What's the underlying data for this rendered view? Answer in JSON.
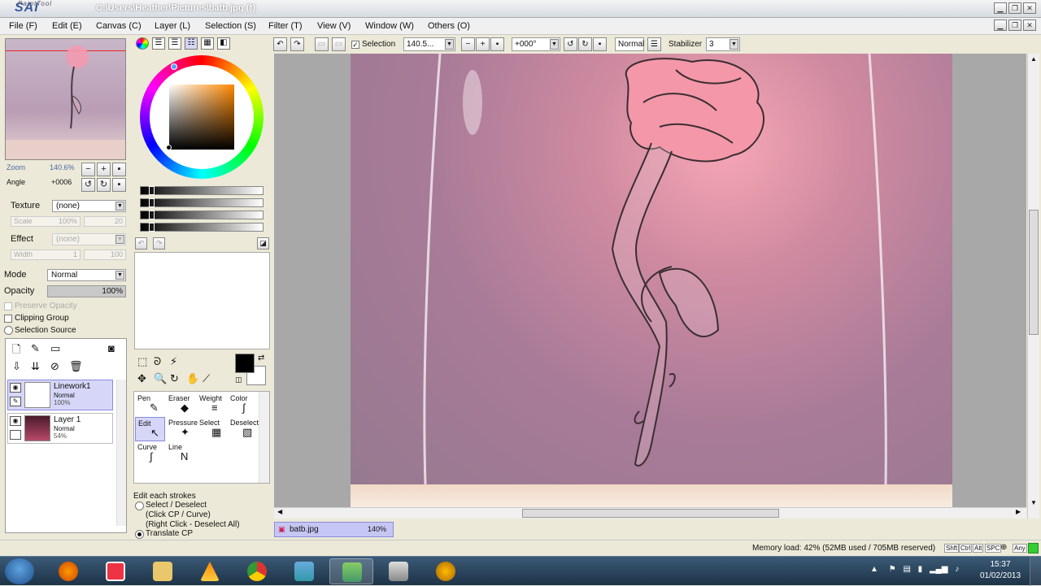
{
  "window": {
    "app_logo": "SAI",
    "app_logo_small": "PaintTool",
    "title": "C:\\Users\\Heather\\Pictures\\batb.jpg (*)"
  },
  "menu": [
    "File (F)",
    "Edit (E)",
    "Canvas (C)",
    "Layer (L)",
    "Selection (S)",
    "Filter (T)",
    "View (V)",
    "Window (W)",
    "Others (O)"
  ],
  "navigator": {
    "zoom_label": "Zoom",
    "zoom_value": "140.6%",
    "angle_label": "Angle",
    "angle_value": "+0006"
  },
  "brush_settings": {
    "texture_label": "Texture",
    "texture_value": "(none)",
    "scale_label": "Scale",
    "scale_value": "100%",
    "scale_num": "20",
    "effect_label": "Effect",
    "effect_value": "(none)",
    "width_label": "Width",
    "width_value": "1",
    "width_num": "100"
  },
  "layer_settings": {
    "mode_label": "Mode",
    "mode_value": "Normal",
    "opacity_label": "Opacity",
    "opacity_value": "100%",
    "preserve_opacity": "Preserve Opacity",
    "clipping_group": "Clipping Group",
    "selection_source": "Selection Source"
  },
  "layers": [
    {
      "name": "Linework1",
      "mode": "Normal",
      "opacity": "100%"
    },
    {
      "name": "Layer 1",
      "mode": "Normal",
      "opacity": "54%"
    }
  ],
  "tools": [
    {
      "label": "Pen",
      "icon": "✎"
    },
    {
      "label": "Eraser",
      "icon": "◆"
    },
    {
      "label": "Weight",
      "icon": "≡"
    },
    {
      "label": "Color",
      "icon": "∫"
    },
    {
      "label": "Edit",
      "icon": "↖"
    },
    {
      "label": "Pressure",
      "icon": "✦"
    },
    {
      "label": "Select",
      "icon": "▦"
    },
    {
      "label": "Deselect",
      "icon": "▧"
    },
    {
      "label": "Curve",
      "icon": "∫"
    },
    {
      "label": "Line",
      "icon": "N"
    }
  ],
  "edit_hint": {
    "title": "Edit each strokes",
    "select": "Select / Deselect",
    "select_sub1": "(Click CP / Curve)",
    "select_sub2": "(Right Click - Deselect All)",
    "translate": "Translate CP"
  },
  "toolbar": {
    "selection_label": "Selection",
    "zoom_value": "140.5...",
    "angle_value": "+000°",
    "blend_mode": "Normal",
    "stabilizer_label": "Stabilizer",
    "stabilizer_value": "3"
  },
  "document_tab": {
    "name": "batb.jpg",
    "zoom": "140%"
  },
  "status": {
    "memory": "Memory load: 42% (52MB used / 705MB reserved)",
    "keys": [
      "Shft",
      "Ctrl",
      "Alt",
      "SPC",
      "Any"
    ]
  },
  "taskbar": {
    "time": "15:37",
    "date": "01/02/2013"
  }
}
